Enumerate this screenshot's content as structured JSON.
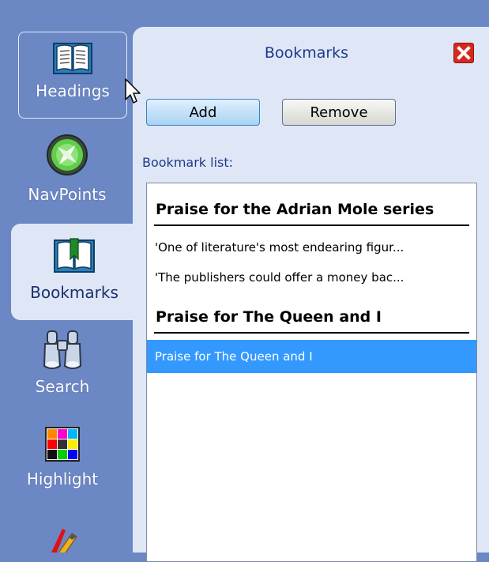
{
  "sidebar": {
    "items": [
      {
        "label": "Headings",
        "icon": "book-icon"
      },
      {
        "label": "NavPoints",
        "icon": "compass-icon"
      },
      {
        "label": "Bookmarks",
        "icon": "bookmark-book-icon"
      },
      {
        "label": "Search",
        "icon": "binoculars-icon"
      },
      {
        "label": "Highlight",
        "icon": "color-grid-icon"
      },
      {
        "icon": "pencil-icon"
      }
    ]
  },
  "panel": {
    "title": "Bookmarks",
    "close_icon": "close-icon",
    "add_label": "Add",
    "remove_label": "Remove",
    "list_label": "Bookmark list:",
    "list": [
      {
        "type": "heading",
        "text": "Praise for the Adrian Mole series"
      },
      {
        "type": "item",
        "text": "'One of literature's most endearing figur..."
      },
      {
        "type": "item",
        "text": "'The publishers could offer a money bac..."
      },
      {
        "type": "heading",
        "text": "Praise for The Queen and I"
      },
      {
        "type": "item",
        "text": "Praise for The Queen and I",
        "selected": true
      }
    ]
  },
  "colors": {
    "sidebar_bg": "#6b87c4",
    "panel_bg": "#dfe7f7",
    "selection": "#3399ff",
    "title_text": "#1e3a8a",
    "close_red": "#d7281d"
  }
}
